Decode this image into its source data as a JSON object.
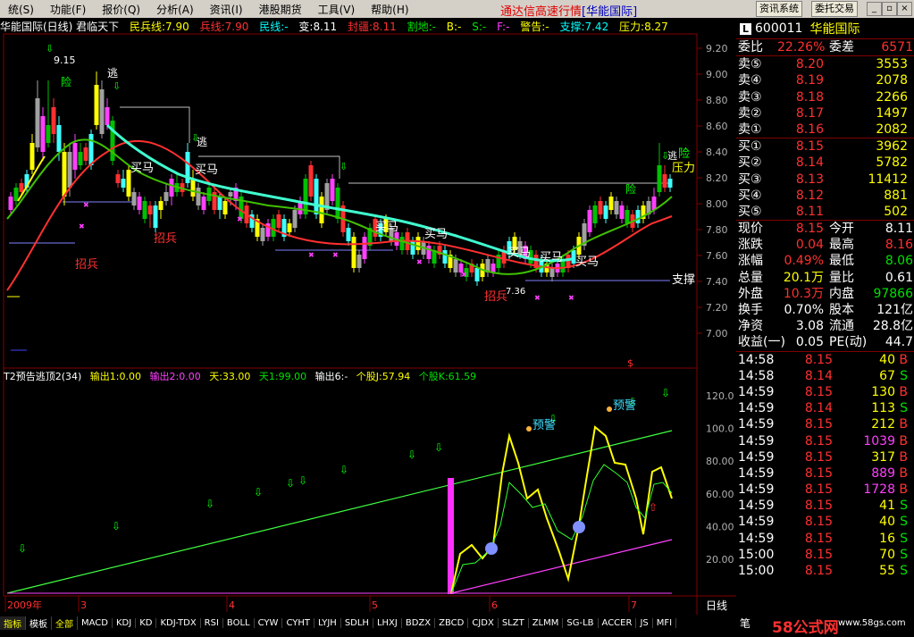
{
  "menu": {
    "items": [
      "统(S)",
      "功能(F)",
      "报价(Q)",
      "分析(A)",
      "资讯(I)",
      "港股期货",
      "工具(V)",
      "帮助(H)"
    ],
    "title_prefix": "通达信高速行情",
    "title_broker": "[华能国际]",
    "btn_info": "资讯系统",
    "btn_trade": "委托交易"
  },
  "main_info": {
    "title": "华能国际(日线) 君临天下",
    "minbing": "民兵线:7.90",
    "bing": "兵线:7.90",
    "min": "民线:-",
    "bian": "变:8.11",
    "fengluo": "封疆:8.11",
    "gedi": "割地:-",
    "b": "B:-",
    "s": "S:-",
    "f": "F:-",
    "warn": "警告:-",
    "support": "支撑:7.42",
    "pressure": "压力:8.27"
  },
  "ind2_info": {
    "title": "T2预告逃顶2(34)",
    "out1": "输出1:0.00",
    "out2": "输出2:0.00",
    "tian": "天:33.00",
    "tian1": "天1:99.00",
    "out6": "输出6:-",
    "gj": "个股J:57.94",
    "gk": "个股K:61.59"
  },
  "price_axis": [
    "9.20",
    "9.00",
    "8.80",
    "8.60",
    "8.40",
    "8.20",
    "8.00",
    "7.80",
    "7.60",
    "7.40",
    "7.20",
    "7.00"
  ],
  "ind_axis": [
    "120.0",
    "100.0",
    "80.00",
    "60.00",
    "40.00",
    "20.00"
  ],
  "time_axis": [
    "2009年",
    "3",
    "4",
    "5",
    "6",
    "7"
  ],
  "period_label": "日线",
  "chart_labels": {
    "high": "9.15",
    "low": "7.36",
    "escape": "逃",
    "danger": "险",
    "buy_horse": "买马",
    "recruit": "招兵",
    "support": "支撑",
    "pressure": "压力",
    "prewarn": "预警",
    "dollar": "$"
  },
  "quote": {
    "code": "600011",
    "name": "华能国际",
    "weibi_label": "委比",
    "weibi": "22.26%",
    "weicha_label": "委差",
    "weicha": "6571",
    "asks": [
      {
        "label": "卖⑤",
        "price": "8.20",
        "vol": "3553"
      },
      {
        "label": "卖④",
        "price": "8.19",
        "vol": "2078"
      },
      {
        "label": "卖③",
        "price": "8.18",
        "vol": "2266"
      },
      {
        "label": "卖②",
        "price": "8.17",
        "vol": "1497"
      },
      {
        "label": "卖①",
        "price": "8.16",
        "vol": "2082"
      }
    ],
    "bids": [
      {
        "label": "买①",
        "price": "8.15",
        "vol": "3962"
      },
      {
        "label": "买②",
        "price": "8.14",
        "vol": "5782"
      },
      {
        "label": "买③",
        "price": "8.13",
        "vol": "11412"
      },
      {
        "label": "买④",
        "price": "8.12",
        "vol": "881"
      },
      {
        "label": "买⑤",
        "price": "8.11",
        "vol": "502"
      }
    ],
    "stats": [
      {
        "l1": "现价",
        "v1": "8.15",
        "c1": "red",
        "l2": "今开",
        "v2": "8.11",
        "c2": "wht"
      },
      {
        "l1": "涨跌",
        "v1": "0.04",
        "c1": "red",
        "l2": "最高",
        "v2": "8.16",
        "c2": "red"
      },
      {
        "l1": "涨幅",
        "v1": "0.49%",
        "c1": "red",
        "l2": "最低",
        "v2": "8.06",
        "c2": "grn"
      },
      {
        "l1": "总量",
        "v1": "20.1万",
        "c1": "yel",
        "l2": "量比",
        "v2": "0.61",
        "c2": "wht"
      },
      {
        "l1": "外盘",
        "v1": "10.3万",
        "c1": "red",
        "l2": "内盘",
        "v2": "97866",
        "c2": "grn"
      },
      {
        "l1": "换手",
        "v1": "0.70%",
        "c1": "wht",
        "l2": "股本",
        "v2": "121亿",
        "c2": "wht"
      },
      {
        "l1": "净资",
        "v1": "3.08",
        "c1": "wht",
        "l2": "流通",
        "v2": "28.8亿",
        "c2": "wht"
      },
      {
        "l1": "收益(一)",
        "v1": "0.05",
        "c1": "wht",
        "l2": "PE(动)",
        "v2": "44.7",
        "c2": "wht"
      }
    ],
    "ticks": [
      {
        "t": "14:58",
        "p": "8.15",
        "v": "40",
        "bs": "B",
        "c": "red"
      },
      {
        "t": "14:58",
        "p": "8.14",
        "v": "67",
        "bs": "S",
        "c": "grn"
      },
      {
        "t": "14:59",
        "p": "8.15",
        "v": "130",
        "bs": "B",
        "c": "red"
      },
      {
        "t": "14:59",
        "p": "8.14",
        "v": "113",
        "bs": "S",
        "c": "grn"
      },
      {
        "t": "14:59",
        "p": "8.15",
        "v": "212",
        "bs": "B",
        "c": "red"
      },
      {
        "t": "14:59",
        "p": "8.15",
        "v": "1039",
        "bs": "B",
        "c": "red"
      },
      {
        "t": "14:59",
        "p": "8.15",
        "v": "317",
        "bs": "B",
        "c": "red"
      },
      {
        "t": "14:59",
        "p": "8.15",
        "v": "889",
        "bs": "B",
        "c": "red"
      },
      {
        "t": "14:59",
        "p": "8.15",
        "v": "1728",
        "bs": "B",
        "c": "red"
      },
      {
        "t": "14:59",
        "p": "8.15",
        "v": "41",
        "bs": "S",
        "c": "grn"
      },
      {
        "t": "14:59",
        "p": "8.15",
        "v": "40",
        "bs": "S",
        "c": "grn"
      },
      {
        "t": "14:59",
        "p": "8.15",
        "v": "16",
        "bs": "S",
        "c": "grn"
      },
      {
        "t": "15:00",
        "p": "8.15",
        "v": "70",
        "bs": "S",
        "c": "grn"
      },
      {
        "t": "15:00",
        "p": "8.15",
        "v": "55",
        "bs": "S",
        "c": "grn"
      }
    ]
  },
  "tabs": [
    "指标",
    "模板",
    "全部",
    "MACD",
    "KDJ",
    "KD",
    "KDJ-TDX",
    "RSI",
    "BOLL",
    "CYW",
    "CYHT",
    "LYJH",
    "SDLH",
    "LHXJ",
    "BDZX",
    "ZBCD",
    "CJDX",
    "SLZT",
    "ZLMM",
    "SG-LB",
    "ACCER",
    "JS",
    "MFI"
  ],
  "footer": {
    "tab": "笔",
    "watermark": "58公式网",
    "url": "www.58gs.com"
  }
}
